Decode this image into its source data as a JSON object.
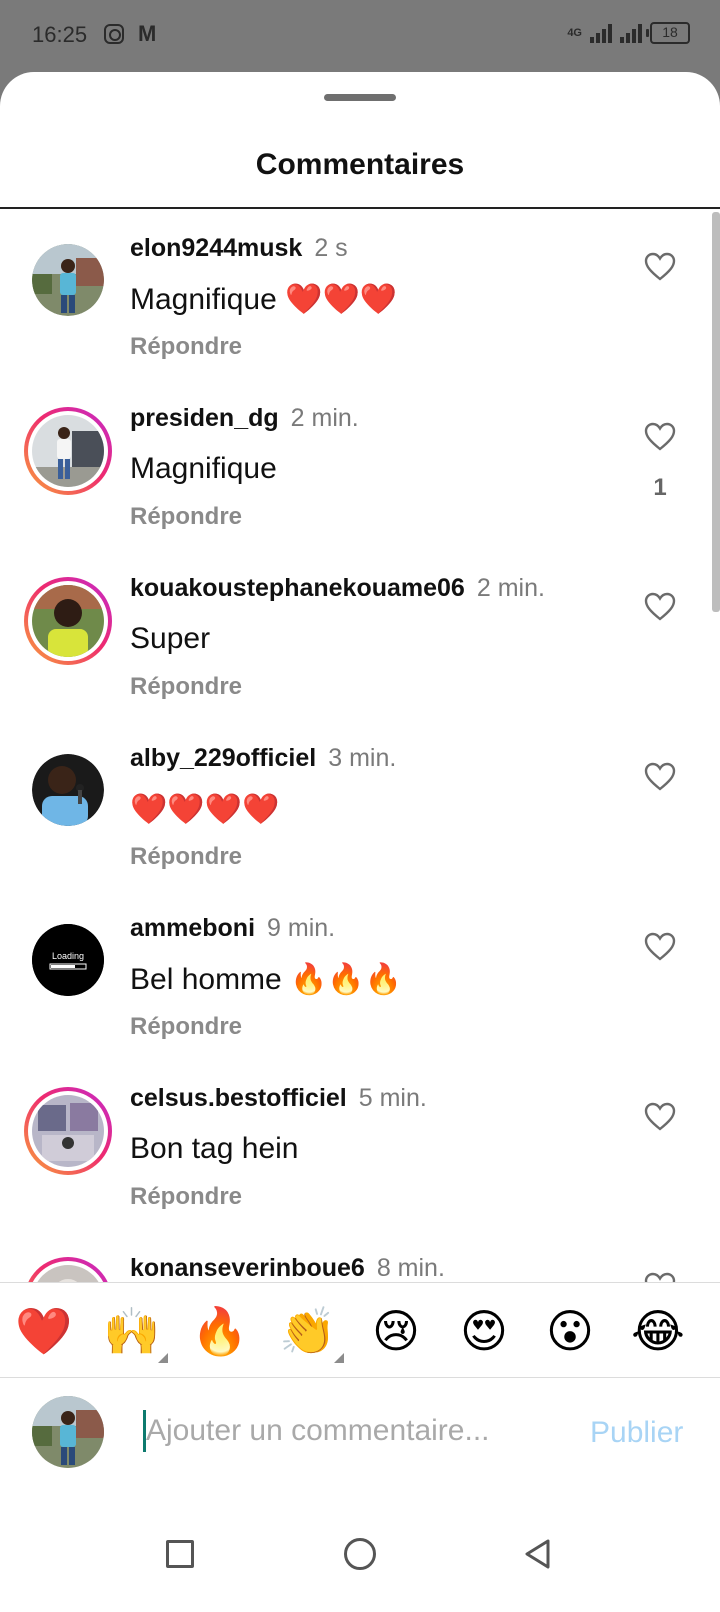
{
  "status_bar": {
    "time": "16:25",
    "mail_icon": "M",
    "network_label": "4G",
    "battery": "18"
  },
  "sheet": {
    "title": "Commentaires"
  },
  "comments": [
    {
      "username": "elon9244musk",
      "time": "2 s",
      "text": "Magnifique ❤️❤️❤️",
      "reply": "Répondre",
      "likes": "",
      "story_ring": false,
      "avatar": "photo-man-blue-shirt"
    },
    {
      "username": "presiden_dg",
      "time": "2 min.",
      "text": "Magnifique",
      "reply": "Répondre",
      "likes": "1",
      "story_ring": true,
      "avatar": "photo-man-white-shirt"
    },
    {
      "username": "kouakoustephanekouame06",
      "time": "2 min.",
      "text": "Super",
      "reply": "Répondre",
      "likes": "",
      "story_ring": true,
      "avatar": "photo-man-yellow-shirt"
    },
    {
      "username": "alby_229officiel",
      "time": "3 min.",
      "text": "❤️❤️❤️❤️",
      "reply": "Répondre",
      "likes": "",
      "story_ring": false,
      "avatar": "photo-man-microphone"
    },
    {
      "username": "ammeboni",
      "time": "9 min.",
      "text": "Bel homme 🔥🔥🔥",
      "reply": "Répondre",
      "likes": "",
      "story_ring": false,
      "avatar": "loading-logo"
    },
    {
      "username": "celsus.bestofficiel",
      "time": "5 min.",
      "text": "Bon tag hein",
      "reply": "Répondre",
      "likes": "",
      "story_ring": true,
      "avatar": "photo-collage"
    },
    {
      "username": "konanseverinboue6",
      "time": "8 min.",
      "text": "",
      "reply": "",
      "likes": "",
      "story_ring": true,
      "avatar": "photo-partial"
    }
  ],
  "loading_avatar_text": "Loading",
  "reactions": [
    "❤️",
    "🙌",
    "🔥",
    "👏",
    "😢",
    "😍",
    "😮",
    "😂"
  ],
  "composer": {
    "placeholder": "Ajouter un commentaire...",
    "publish_label": "Publier"
  },
  "icons": {
    "like": "heart-outline-icon",
    "nav_recent": "square-icon",
    "nav_home": "circle-icon",
    "nav_back": "triangle-back-icon"
  },
  "colors": {
    "story_ring_start": "#f9a33a",
    "story_ring_end": "#c22ad0",
    "publish_disabled": "#a8d4f5",
    "caret": "#0d7a6e"
  }
}
